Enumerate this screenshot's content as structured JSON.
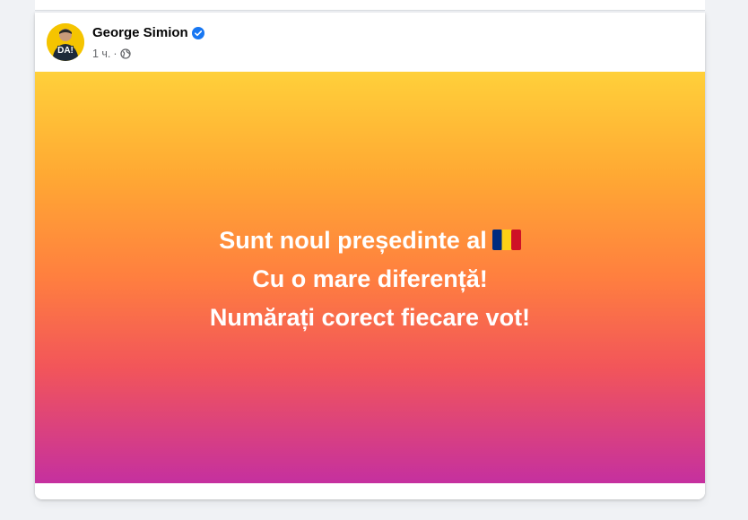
{
  "post": {
    "author": {
      "name": "George Simion",
      "verified": true,
      "avatar_text": "DA!"
    },
    "time": "1 ч.",
    "separator": "·",
    "privacy_icon": "globe-icon",
    "background": {
      "colors": [
        "#ffd03a",
        "#ffa933",
        "#ff7f3f",
        "#f2555a",
        "#c5309f"
      ]
    },
    "text_lines": [
      "Sunt noul președinte al",
      "Cu o mare diferență!",
      "Numărați corect fiecare vot!"
    ],
    "flag_icon": "romania-flag-icon",
    "flag_colors": [
      "#002b7f",
      "#fcd116",
      "#ce1126"
    ]
  },
  "colors": {
    "verified": "#1877f2",
    "page_bg": "#f0f2f5"
  }
}
